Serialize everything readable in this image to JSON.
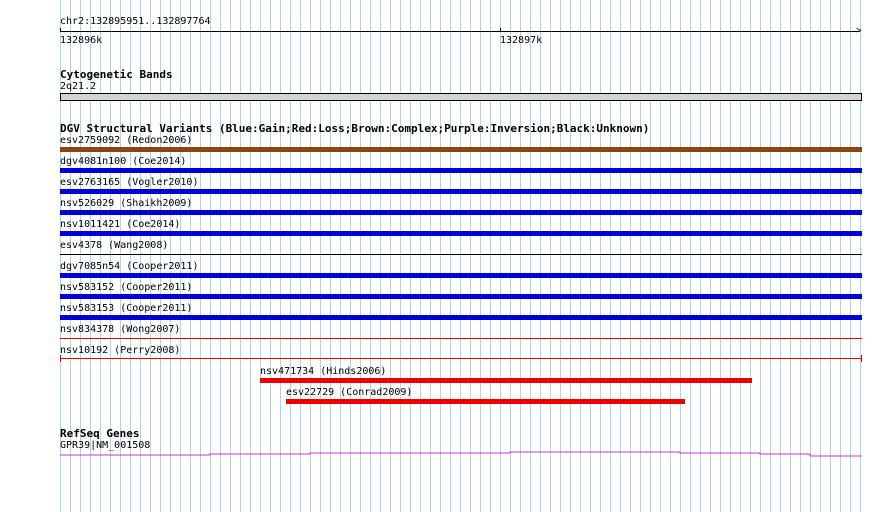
{
  "ruler": {
    "range": "chr2:132895951..132897764",
    "tick1": "132896k",
    "tick2": "132897k"
  },
  "cytobands": {
    "title": "Cytogenetic Bands",
    "band": "2q21.2"
  },
  "dgv": {
    "title": "DGV Structural Variants (Blue:Gain;Red:Loss;Brown:Complex;Purple:Inversion;Black:Unknown)",
    "colors": {
      "gain": "#0000dd",
      "loss": "#ee0000",
      "complex": "#8b4513",
      "unknown": "#000000"
    },
    "items": [
      {
        "label": "esv2759092 (Redon2006)",
        "type": "complex"
      },
      {
        "label": "dgv4081n100 (Coe2014)",
        "type": "gain"
      },
      {
        "label": "esv2763165 (Vogler2010)",
        "type": "gain"
      },
      {
        "label": "nsv526029 (Shaikh2009)",
        "type": "gain"
      },
      {
        "label": "nsv1011421 (Coe2014)",
        "type": "gain"
      },
      {
        "label": "esv4378 (Wang2008)",
        "type": "unknown"
      },
      {
        "label": "dgv7085n54 (Cooper2011)",
        "type": "gain"
      },
      {
        "label": "nsv583152 (Cooper2011)",
        "type": "gain"
      },
      {
        "label": "nsv583153 (Cooper2011)",
        "type": "gain"
      },
      {
        "label": "nsv834378 (Wong2007)",
        "type": "loss"
      },
      {
        "label": "nsv10192 (Perry2008)",
        "type": "loss"
      },
      {
        "label": "nsv471734 (Hinds2006)",
        "type": "loss"
      },
      {
        "label": "esv22729 (Conrad2009)",
        "type": "loss"
      }
    ]
  },
  "refseq": {
    "title": "RefSeq Genes",
    "gene": "GPR39|NM_001508",
    "color": "#cc33cc"
  }
}
